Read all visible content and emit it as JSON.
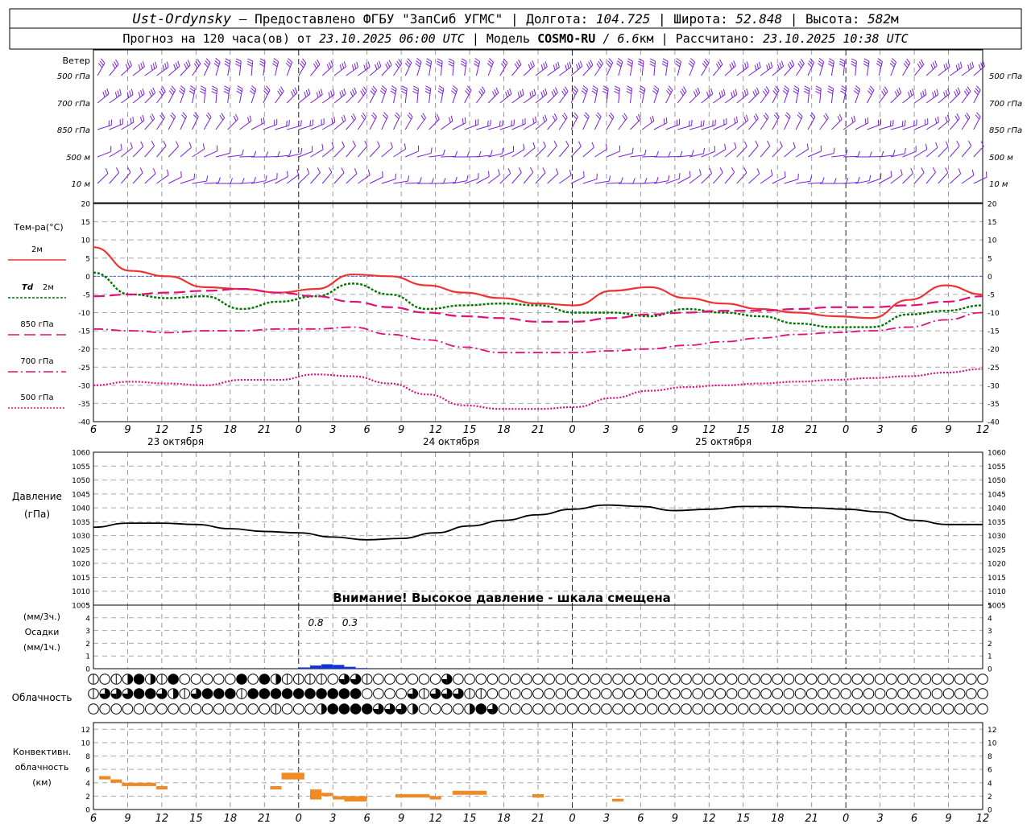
{
  "header": {
    "station": "Ust-Ordynsky",
    "provider": "Предоставлено ФГБУ \"ЗапСиб УГМС\"",
    "lon_label": "Долгота:",
    "lon": "104.725",
    "lat_label": "Широта:",
    "lat": "52.848",
    "alt_label": "Высота:",
    "alt": "582",
    "alt_unit": "м",
    "forecast_prefix": "Прогноз на 120 часа(ов) от",
    "forecast_time": "23.10.2025 06:00 UTC",
    "model_label": "Модель",
    "model": "COSMO-RU",
    "model_res": "/ 6.6",
    "model_res_unit": "км",
    "calc_label": "Рассчитано:",
    "calc_time": "23.10.2025 10:38 UTC"
  },
  "colors": {
    "t2m": "#ee3333",
    "td2m": "#007700",
    "t850": "#e0107a",
    "t700": "#e0107a",
    "t500": "#e0107a",
    "wind": "#7a1fd8",
    "pressure": "#000000",
    "precip": "#1133dd",
    "conv": "#f08a24",
    "ref_line": "#3355ee"
  },
  "time_axis": {
    "ticks": [
      "6",
      "9",
      "12",
      "15",
      "18",
      "21",
      "0",
      "3",
      "6",
      "9",
      "12",
      "15",
      "18",
      "21",
      "0",
      "3",
      "6",
      "9",
      "12",
      "15",
      "18",
      "21",
      "0",
      "3",
      "6",
      "9",
      "12"
    ],
    "dates": [
      "23 октября",
      "24 октября",
      "25 октября"
    ]
  },
  "wind_panel": {
    "title": "Ветер",
    "levels": [
      "500 гПа",
      "700 гПа",
      "850 гПа",
      "500 м",
      "10 м"
    ]
  },
  "panels": {
    "temp": {
      "title": "Тем-ра(°C)",
      "td_symbol": "Td",
      "yticks": [
        "20",
        "15",
        "10",
        "5",
        "0",
        "-5",
        "-10",
        "-15",
        "-20",
        "-25",
        "-30",
        "-35",
        "-40"
      ]
    },
    "pressure": {
      "title": "Давление",
      "unit": "(гПа)",
      "warning": "Внимание! Высокое давление - шкала смещена",
      "yticks": [
        "1060",
        "1055",
        "1050",
        "1045",
        "1040",
        "1035",
        "1030",
        "1025",
        "1020",
        "1015",
        "1010",
        "1005"
      ]
    },
    "precip": {
      "unit_top": "(мм/3ч.)",
      "title": "Осадки",
      "unit_bottom": "(мм/1ч.)",
      "yticks": [
        "5",
        "4",
        "3",
        "2",
        "1",
        "0"
      ],
      "labels": [
        {
          "text": "0.8",
          "h": 27
        },
        {
          "text": "0.3",
          "h": 30
        }
      ]
    },
    "cloud": {
      "title": "Облачность"
    },
    "conv": {
      "title1": "Конвективн.",
      "title2": "облачность",
      "unit": "(км)",
      "yticks": [
        "12",
        "10",
        "8",
        "6",
        "4",
        "2",
        "0"
      ]
    }
  },
  "chart_data": [
    {
      "type": "line",
      "title": "Тем-ра(°C)",
      "x_hours": [
        0,
        3,
        6,
        9,
        12,
        15,
        18,
        21,
        24,
        27,
        30,
        33,
        36,
        39,
        42,
        45,
        48,
        51,
        54,
        57,
        60,
        63,
        66,
        69,
        72,
        75,
        78
      ],
      "ylim": [
        -40,
        20
      ],
      "series": [
        {
          "name": "2м",
          "values": [
            8,
            1.5,
            0,
            -3,
            -3.5,
            -4.5,
            -3.5,
            0.5,
            0,
            -2.5,
            -4.5,
            -6,
            -7.5,
            -8,
            -4,
            -3,
            -6,
            -7.5,
            -9,
            -10,
            -11,
            -11.5,
            -6.5,
            -2.5,
            -5
          ]
        },
        {
          "name": "Td 2м",
          "values": [
            1,
            -5,
            -6,
            -5.5,
            -9,
            -7,
            -5.5,
            -2,
            -5,
            -9,
            -8,
            -7.5,
            -8,
            -10,
            -10,
            -11,
            -9,
            -10,
            -11,
            -13,
            -14,
            -14,
            -10.5,
            -9.5,
            -8
          ]
        },
        {
          "name": "850 гПа",
          "values": [
            -5.5,
            -5,
            -4.5,
            -4,
            -3.5,
            -4.5,
            -5.5,
            -7,
            -8.5,
            -10,
            -11,
            -11.5,
            -12.5,
            -12.5,
            -11.5,
            -10.5,
            -10,
            -9.5,
            -9.5,
            -9,
            -8.5,
            -8.5,
            -8,
            -7,
            -5.5
          ]
        },
        {
          "name": "700 гПа",
          "values": [
            -14.5,
            -15,
            -15.5,
            -15,
            -15,
            -14.5,
            -14.5,
            -14,
            -16,
            -17.5,
            -19.5,
            -21,
            -21,
            -21,
            -20.5,
            -20,
            -19,
            -18,
            -17,
            -16,
            -15.5,
            -15,
            -14,
            -12,
            -10
          ]
        },
        {
          "name": "500 гПа",
          "values": [
            -30,
            -29,
            -29.5,
            -30,
            -28.5,
            -28.5,
            -27,
            -27.5,
            -29.5,
            -32.5,
            -35.5,
            -36.5,
            -36.5,
            -36,
            -33.5,
            -31.5,
            -30.5,
            -30,
            -29.5,
            -29,
            -28.5,
            -28,
            -27.5,
            -26.5,
            -25.5
          ]
        }
      ]
    },
    {
      "type": "line",
      "title": "Давление",
      "ylabel": "(гПа)",
      "ylim": [
        1005,
        1060
      ],
      "series": [
        {
          "name": "Давление",
          "values": [
            1033,
            1034.5,
            1034.5,
            1034,
            1032.5,
            1031.5,
            1031,
            1029.5,
            1028.5,
            1029,
            1031,
            1033.5,
            1035.5,
            1037.5,
            1039.5,
            1041,
            1040.5,
            1039,
            1039.5,
            1040.5,
            1040.5,
            1040,
            1039.5,
            1038.5,
            1035.5,
            1034,
            1034
          ]
        }
      ]
    },
    {
      "type": "bar",
      "title": "Осадки",
      "ylim": [
        0,
        5
      ],
      "categories_hours": [
        18,
        19,
        20,
        21,
        22,
        23
      ],
      "values": [
        0.1,
        0.25,
        0.35,
        0.3,
        0.15,
        0.05
      ]
    },
    {
      "type": "bar",
      "title": "Конвективн. облачность",
      "ylabel": "(км)",
      "ylim": [
        0,
        13
      ],
      "segments": [
        {
          "x0": 0.5,
          "x1": 1.5,
          "base": 4.5,
          "top": 5
        },
        {
          "x0": 1.5,
          "x1": 2.5,
          "base": 4,
          "top": 4.5
        },
        {
          "x0": 2.5,
          "x1": 5.5,
          "base": 3.5,
          "top": 4
        },
        {
          "x0": 5.5,
          "x1": 6.5,
          "base": 3,
          "top": 3.5
        },
        {
          "x0": 15.5,
          "x1": 16.5,
          "base": 3,
          "top": 3.5
        },
        {
          "x0": 16.5,
          "x1": 18.5,
          "base": 4.5,
          "top": 5.5
        },
        {
          "x0": 19.0,
          "x1": 20.0,
          "base": 1.5,
          "top": 3
        },
        {
          "x0": 20.0,
          "x1": 21.0,
          "base": 2,
          "top": 2.5
        },
        {
          "x0": 21.0,
          "x1": 22.0,
          "base": 1.5,
          "top": 2
        },
        {
          "x0": 22.0,
          "x1": 24.0,
          "base": 1.2,
          "top": 2
        },
        {
          "x0": 26.5,
          "x1": 29.5,
          "base": 1.8,
          "top": 2.3
        },
        {
          "x0": 29.5,
          "x1": 30.5,
          "base": 1.5,
          "top": 2
        },
        {
          "x0": 31.5,
          "x1": 34.5,
          "base": 2.2,
          "top": 2.8
        },
        {
          "x0": 38.5,
          "x1": 39.5,
          "base": 1.8,
          "top": 2.3
        },
        {
          "x0": 45.5,
          "x1": 46.5,
          "base": 1.2,
          "top": 1.6
        }
      ]
    },
    {
      "type": "table",
      "title": "Облачность",
      "rows": [
        "tuthfhtfeeeeefefhtttteqqteeeeeeqeeeeeeeeeeeeeeeeeeeeeeeeeeeeeeeeeeeeeeeeeeeeeeeeeeeeee",
        "tqqqffqhtqffftffffffffffeeeeqtqqqtteeeeeeeeeeeeeeeeeeeeeeeeeeeeeeeeeeeeeeeeeeeeeeeeeeee",
        "eeeeeeeeeeeeeeeeteeehffffqqqheeeehfqeeeeeeeeeeeeeeeeeeeeeeeeeeeeeeeeeeeeeeeeeeeeeeeeeee"
      ]
    }
  ]
}
